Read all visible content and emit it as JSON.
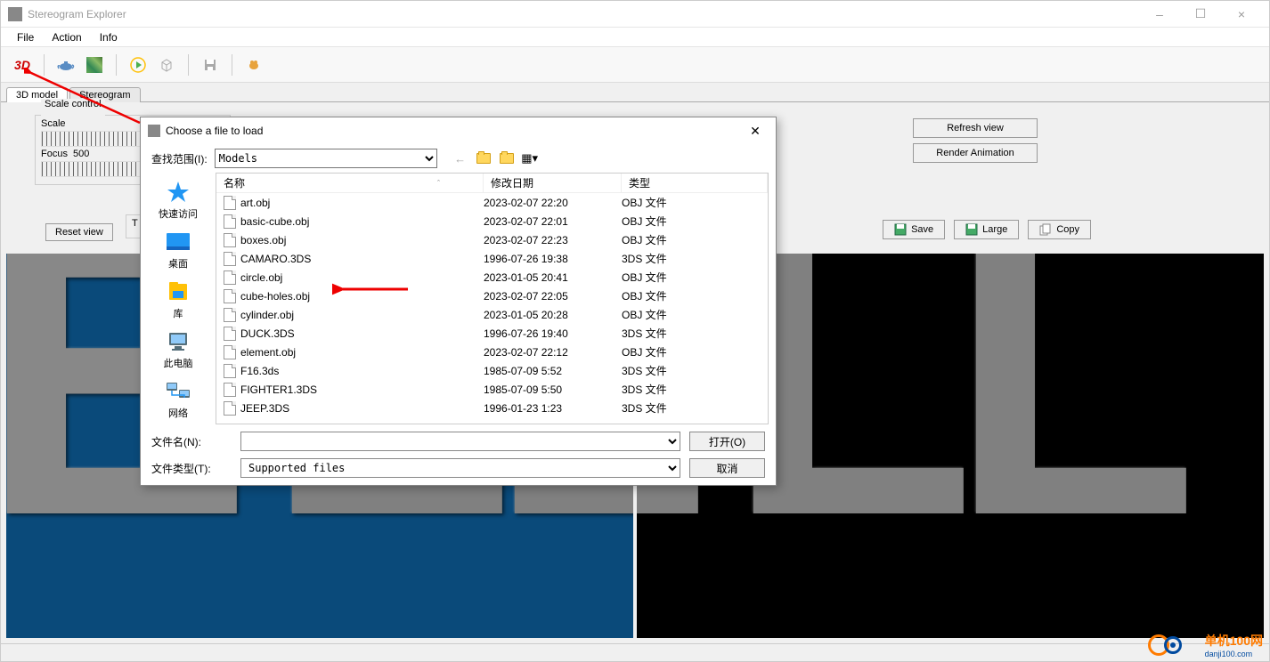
{
  "window": {
    "title": "Stereogram Explorer",
    "minimize": "–",
    "maximize": "☐",
    "close": "×"
  },
  "menubar": {
    "file": "File",
    "action": "Action",
    "info": "Info"
  },
  "toolbar_icons": {
    "b3d": "3D",
    "teapot": "teapot",
    "texture": "texture",
    "play": "play",
    "cube": "cube",
    "save": "save",
    "bug": "bug"
  },
  "tabs": {
    "model": "3D model",
    "stereogram": "Stereogram"
  },
  "scale_panel": {
    "legend": "Scale control",
    "scale_label": "Scale",
    "focus_label": "Focus",
    "focus_value": "500"
  },
  "reset_view": "Reset view",
  "truncated_T": "T",
  "right_buttons": {
    "refresh": "Refresh view",
    "render": "Render Animation"
  },
  "save_buttons": {
    "save": "Save",
    "large": "Large",
    "copy": "Copy"
  },
  "file_dialog": {
    "title": "Choose a file to load",
    "lookin_label": "查找范围(I):",
    "lookin_value": "Models",
    "places": {
      "quick": "快速访问",
      "desktop": "桌面",
      "libraries": "库",
      "thispc": "此电脑",
      "network": "网络"
    },
    "headers": {
      "name": "名称",
      "date": "修改日期",
      "type": "类型"
    },
    "files": [
      {
        "name": "art.obj",
        "date": "2023-02-07 22:20",
        "type": "OBJ 文件"
      },
      {
        "name": "basic-cube.obj",
        "date": "2023-02-07 22:01",
        "type": "OBJ 文件"
      },
      {
        "name": "boxes.obj",
        "date": "2023-02-07 22:23",
        "type": "OBJ 文件"
      },
      {
        "name": "CAMARO.3DS",
        "date": "1996-07-26 19:38",
        "type": "3DS 文件"
      },
      {
        "name": "circle.obj",
        "date": "2023-01-05 20:41",
        "type": "OBJ 文件"
      },
      {
        "name": "cube-holes.obj",
        "date": "2023-02-07 22:05",
        "type": "OBJ 文件"
      },
      {
        "name": "cylinder.obj",
        "date": "2023-01-05 20:28",
        "type": "OBJ 文件"
      },
      {
        "name": "DUCK.3DS",
        "date": "1996-07-26 19:40",
        "type": "3DS 文件"
      },
      {
        "name": "element.obj",
        "date": "2023-02-07 22:12",
        "type": "OBJ 文件"
      },
      {
        "name": "F16.3ds",
        "date": "1985-07-09 5:52",
        "type": "3DS 文件"
      },
      {
        "name": "FIGHTER1.3DS",
        "date": "1985-07-09 5:50",
        "type": "3DS 文件"
      },
      {
        "name": "JEEP.3DS",
        "date": "1996-01-23 1:23",
        "type": "3DS 文件"
      }
    ],
    "filename_label": "文件名(N):",
    "filename_value": "",
    "filetype_label": "文件类型(T):",
    "filetype_value": "Supported files",
    "open_btn": "打开(O)",
    "cancel_btn": "取消"
  },
  "watermark": {
    "brand": "单机100网",
    "url": "danji100.com"
  }
}
